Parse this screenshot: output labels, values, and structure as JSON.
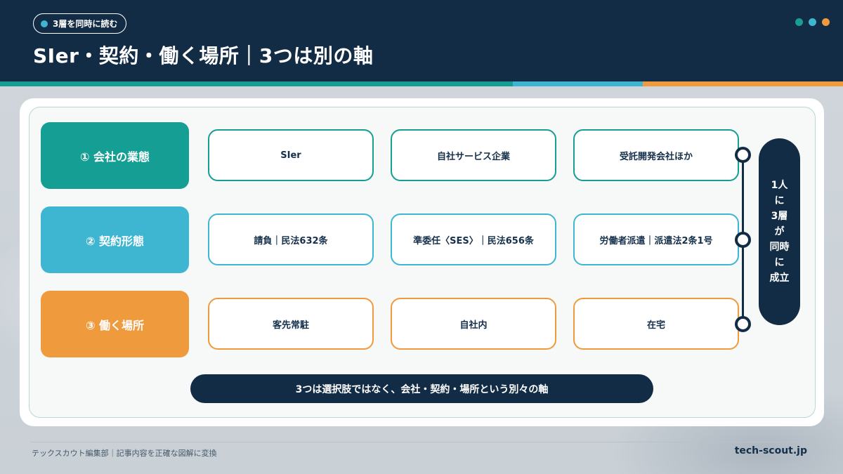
{
  "header": {
    "tag": "3層を同時に読む",
    "title": "SIer・契約・働く場所｜3つは別の軸",
    "dots": [
      "#1a9e93",
      "#3fb6d1",
      "#f0993e"
    ]
  },
  "colors": {
    "teal": "#159e93",
    "cyan": "#3fb6d1",
    "orange": "#f09a3e",
    "navy": "#132c45"
  },
  "rows": [
    {
      "label": "① 会社の業態",
      "cells": [
        "SIer",
        "自社サービス企業",
        "受託開発会社ほか"
      ]
    },
    {
      "label": "② 契約形態",
      "cells": [
        "請負｜民法632条",
        "準委任〈SES〉｜民法656条",
        "労働者派遣｜派遣法2条1号"
      ]
    },
    {
      "label": "③ 働く場所",
      "cells": [
        "客先常駐",
        "自社内",
        "在宅"
      ]
    }
  ],
  "side": {
    "lines": [
      "1人",
      "に",
      "3層",
      "が",
      "同時",
      "に",
      "成立"
    ]
  },
  "summary": "3つは選択肢ではなく、会社・契約・場所という別々の軸",
  "footer": {
    "left": "テックスカウト編集部｜記事内容を正確な図解に変換",
    "right": "tech-scout.jp"
  }
}
